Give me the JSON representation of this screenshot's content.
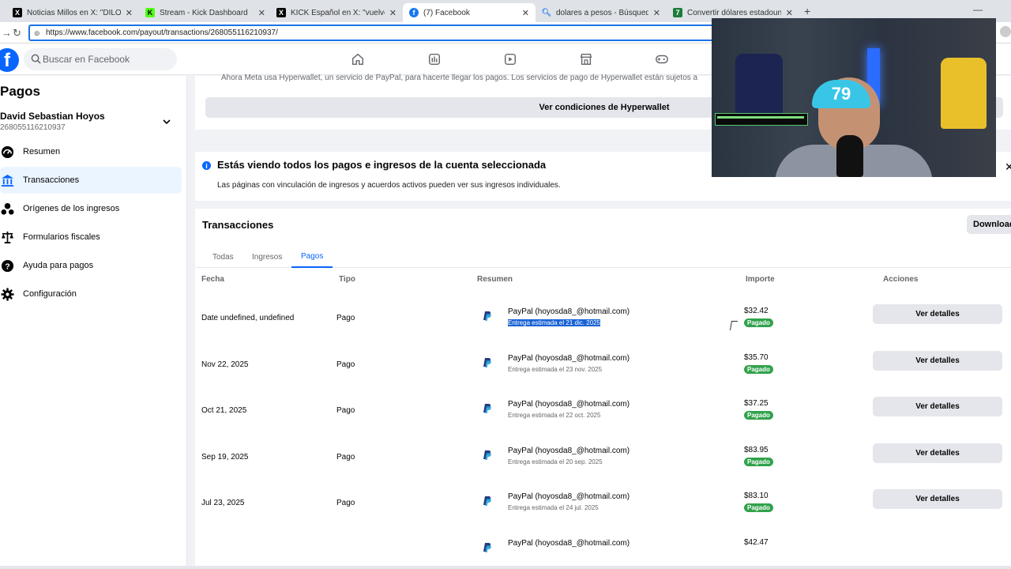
{
  "browser": {
    "tabs": [
      {
        "label": "Noticias Millos en X: \"DILO SIN MI",
        "favicon": "x-icon"
      },
      {
        "label": "Stream - Kick Dashboard",
        "favicon": "kick-icon"
      },
      {
        "label": "KICK Español en X: \"vuelve el bras",
        "favicon": "x-icon"
      },
      {
        "label": "(7) Facebook",
        "favicon": "facebook-icon",
        "active": true
      },
      {
        "label": "dolares a pesos - Búsqueda",
        "favicon": "search-icon"
      },
      {
        "label": "Convertir dólares estadounidense",
        "favicon": "converter-icon"
      }
    ],
    "url": "https://www.facebook.com/payout/transactions/268055116210937/"
  },
  "header": {
    "search_placeholder": "Buscar en Facebook"
  },
  "sidebar": {
    "title": "Pagos",
    "account_name": "David Sebastian Hoyos",
    "account_id": "268055116210937",
    "items": [
      {
        "label": "Resumen",
        "icon": "dashboard-icon"
      },
      {
        "label": "Transacciones",
        "icon": "bank-icon",
        "active": true
      },
      {
        "label": "Orígenes de los ingresos",
        "icon": "sources-icon"
      },
      {
        "label": "Formularios fiscales",
        "icon": "scale-icon"
      },
      {
        "label": "Ayuda para pagos",
        "icon": "help-icon"
      },
      {
        "label": "Configuración",
        "icon": "gear-icon"
      }
    ]
  },
  "hyperwallet": {
    "text": "Ahora Meta usa Hyperwallet, un servicio de PayPal, para hacerte llegar los pagos. Los servicios de pago de Hyperwallet están sujetos a",
    "button": "Ver condiciones de Hyperwallet"
  },
  "info": {
    "title": "Estás viendo todos los pagos e ingresos de la cuenta seleccionada",
    "subtitle": "Las páginas con vinculación de ingresos y acuerdos activos pueden ver sus ingresos individuales."
  },
  "transactions": {
    "title": "Transacciones",
    "download": "Download",
    "tabs": [
      "Todas",
      "Ingresos",
      "Pagos"
    ],
    "active_tab": "Pagos",
    "columns": [
      "Fecha",
      "Tipo",
      "Resumen",
      "Importe",
      "Acciones"
    ],
    "rows": [
      {
        "date": "Date undefined, undefined",
        "type": "Pago",
        "method": "PayPal (hoyosda8_@hotmail.com)",
        "delivery": "Entrega estimada el 21 dic. 2025",
        "amount": "$32.42",
        "status": "Pagado",
        "action": "Ver detalles",
        "selected": true
      },
      {
        "date": "Nov 22, 2025",
        "type": "Pago",
        "method": "PayPal (hoyosda8_@hotmail.com)",
        "delivery": "Entrega estimada el 23 nov. 2025",
        "amount": "$35.70",
        "status": "Pagado",
        "action": "Ver detalles"
      },
      {
        "date": "Oct 21, 2025",
        "type": "Pago",
        "method": "PayPal (hoyosda8_@hotmail.com)",
        "delivery": "Entrega estimada el 22 oct. 2025",
        "amount": "$37.25",
        "status": "Pagado",
        "action": "Ver detalles"
      },
      {
        "date": "Sep 19, 2025",
        "type": "Pago",
        "method": "PayPal (hoyosda8_@hotmail.com)",
        "delivery": "Entrega estimada el 20 sep. 2025",
        "amount": "$83.95",
        "status": "Pagado",
        "action": "Ver detalles"
      },
      {
        "date": "Jul 23, 2025",
        "type": "Pago",
        "method": "PayPal (hoyosda8_@hotmail.com)",
        "delivery": "Entrega estimada el 24 jul. 2025",
        "amount": "$83.10",
        "status": "Pagado",
        "action": "Ver detalles"
      },
      {
        "date": "",
        "type": "",
        "method": "PayPal (hoyosda8_@hotmail.com)",
        "delivery": "",
        "amount": "$42.47",
        "status": "",
        "action": ""
      }
    ]
  },
  "webcam": {
    "cap_number": "79"
  },
  "colors": {
    "brand": "#0866ff",
    "paid": "#31a24c",
    "selection": "#1a63d4"
  }
}
